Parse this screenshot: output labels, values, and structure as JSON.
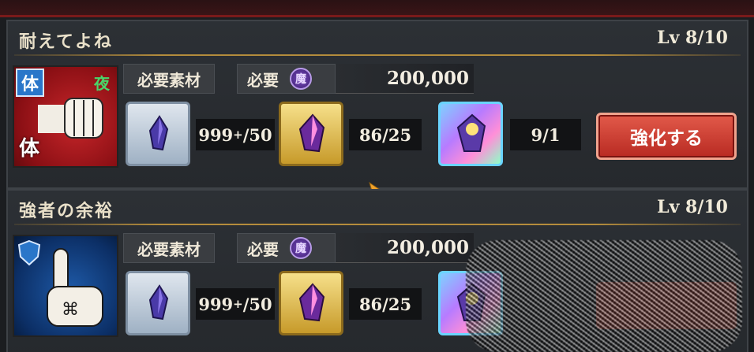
{
  "skills": [
    {
      "name": "耐えてよね",
      "level": "Lv 8/10",
      "type_badge": "体",
      "type_bottom": "体",
      "time_badge": "夜",
      "icon": "fist-icon",
      "materials_label": "必要素材",
      "required_label": "必要",
      "currency_icon": "gem-coin-icon",
      "currency_glyph": "魔",
      "cost": "200,000",
      "items": [
        {
          "icon": "silver-crystal-icon",
          "count": "999",
          "plus": "+",
          "need": "/50"
        },
        {
          "icon": "gold-crystal-icon",
          "count": "86/25"
        },
        {
          "icon": "rainbow-crystal-icon",
          "count": "9/1"
        }
      ],
      "action": "強化する"
    },
    {
      "name": "強者の余裕",
      "level": "Lv 8/10",
      "icon": "pointing-finger-icon",
      "materials_label": "必要素材",
      "required_label": "必要",
      "currency_icon": "gem-coin-icon",
      "currency_glyph": "魔",
      "cost": "200,000",
      "items": [
        {
          "icon": "silver-crystal-icon",
          "count": "999",
          "plus": "+",
          "need": "/50"
        },
        {
          "icon": "gold-crystal-icon",
          "count": "86/25"
        },
        {
          "icon": "rainbow-crystal-icon"
        }
      ]
    }
  ],
  "colors": {
    "panel_bg": "#2a2e33",
    "accent_gold": "#b48c3c",
    "button_red": "#c8372c"
  }
}
